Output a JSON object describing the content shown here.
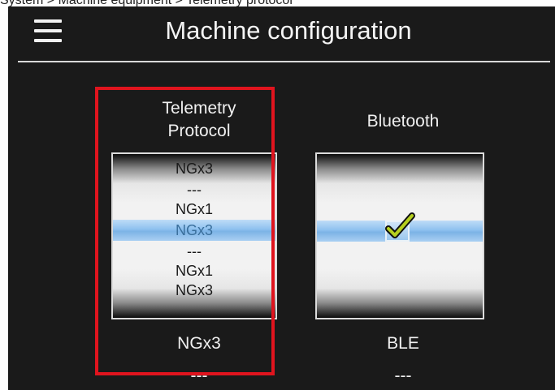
{
  "breadcrumb": "System > Machine equipment > Telemetry protocol",
  "header": {
    "title": "Machine configuration"
  },
  "telemetry": {
    "label_line1": "Telemetry",
    "label_line2": "Protocol",
    "picker_items": [
      "NGx3",
      "---",
      "NGx1",
      "NGx3",
      "---",
      "NGx1",
      "NGx3"
    ],
    "selected_index": 3,
    "value": "NGx3",
    "secondary_value": "---"
  },
  "bluetooth": {
    "label": "Bluetooth",
    "checked": true,
    "value": "BLE",
    "secondary_value": "---"
  },
  "colors": {
    "background": "#1a1a1a",
    "highlight": "#8ec1ef",
    "selection_outline": "#e0141e",
    "checkmark_fill": "#b5cf1f"
  },
  "icons": {
    "menu": "hamburger-icon",
    "check": "checkmark-icon"
  }
}
